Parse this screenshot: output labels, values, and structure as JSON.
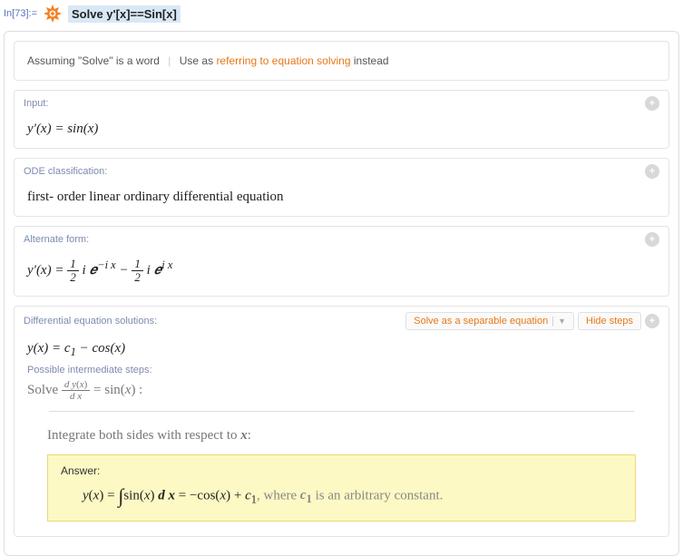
{
  "prompt": {
    "label": "In[73]:=",
    "query": "Solve y'[x]==Sin[x]"
  },
  "assumption": {
    "text1": "Assuming \"Solve\" is a word",
    "sep": "|",
    "use_as": "Use as",
    "link": "referring to equation solving",
    "instead": "instead"
  },
  "pods": {
    "input": {
      "title": "Input:",
      "expr": "y′(x) = sin(x)"
    },
    "classification": {
      "title": "ODE classification:",
      "text": "first- order linear ordinary differential equation"
    },
    "alternate": {
      "title": "Alternate form:"
    },
    "solutions": {
      "title": "Differential equation solutions:",
      "separable_btn": "Solve as a separable equation",
      "hide_btn": "Hide steps",
      "intermediate_label": "Possible intermediate steps:",
      "solve_word": "Solve",
      "integrate_desc": "Integrate both sides with respect to x:",
      "answer_label": "Answer:",
      "answer_tail": ", where c₁ is an arbitrary constant."
    }
  }
}
